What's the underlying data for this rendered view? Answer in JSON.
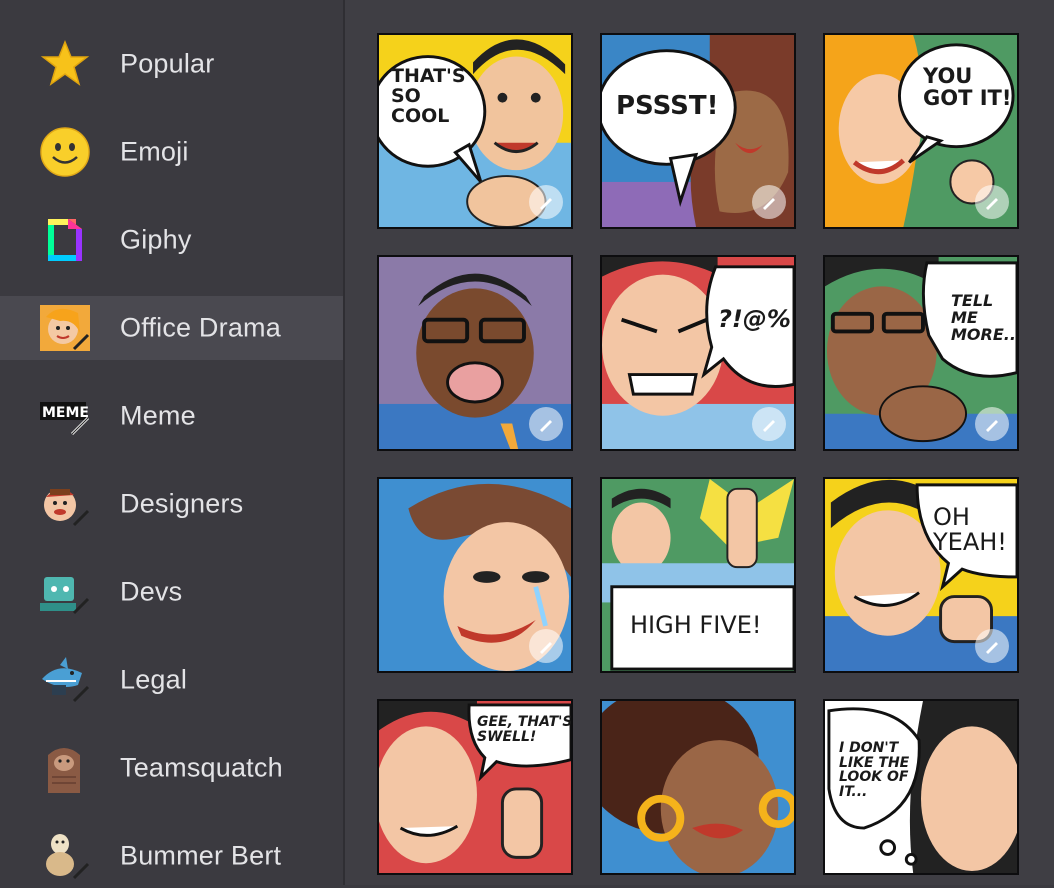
{
  "sidebar": {
    "items": [
      {
        "label": "Popular",
        "icon": "star-icon"
      },
      {
        "label": "Emoji",
        "icon": "smiley-icon"
      },
      {
        "label": "Giphy",
        "icon": "giphy-icon"
      },
      {
        "label": "Office Drama",
        "icon": "office-drama-icon",
        "active": true
      },
      {
        "label": "Meme",
        "icon": "meme-icon"
      },
      {
        "label": "Designers",
        "icon": "designers-icon"
      },
      {
        "label": "Devs",
        "icon": "devs-icon"
      },
      {
        "label": "Legal",
        "icon": "legal-shark-icon"
      },
      {
        "label": "Teamsquatch",
        "icon": "teamsquatch-icon"
      },
      {
        "label": "Bummer Bert",
        "icon": "bummer-bert-icon"
      }
    ]
  },
  "stickers": [
    {
      "caption": "THAT'S SO COOL"
    },
    {
      "caption": "PSSST!"
    },
    {
      "caption": "YOU GOT IT!"
    },
    {
      "caption": ""
    },
    {
      "caption": "?!@%"
    },
    {
      "caption": "TELL ME MORE..."
    },
    {
      "caption": ""
    },
    {
      "caption": "HIGH FIVE!"
    },
    {
      "caption": "OH YEAH!"
    },
    {
      "caption": "GEE, THAT'S SWELL!"
    },
    {
      "caption": ""
    },
    {
      "caption": "I DON'T LIKE THE LOOK OF IT..."
    }
  ],
  "colors": {
    "background": "#3b3a40",
    "active_item": "#4a4950",
    "text": "#e3e3e6"
  }
}
